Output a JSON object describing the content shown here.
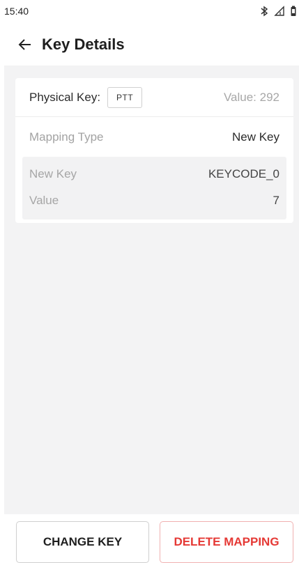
{
  "status_bar": {
    "time": "15:40",
    "icons": [
      "bluetooth-icon",
      "signal-icon",
      "battery-icon"
    ]
  },
  "app_bar": {
    "title": "Key Details",
    "back_icon": "arrow-left-icon"
  },
  "card": {
    "physical_key_label": "Physical Key:",
    "physical_key_chip": "PTT",
    "value_text": "Value: 292",
    "mapping_type_label": "Mapping Type",
    "mapping_type_value": "New Key",
    "details": [
      {
        "label": "New Key",
        "value": "KEYCODE_0"
      },
      {
        "label": "Value",
        "value": "7"
      }
    ]
  },
  "footer": {
    "change_key_label": "CHANGE KEY",
    "delete_mapping_label": "DELETE MAPPING"
  },
  "colors": {
    "background": "#f3f3f4",
    "card": "#ffffff",
    "danger": "#e53935"
  }
}
